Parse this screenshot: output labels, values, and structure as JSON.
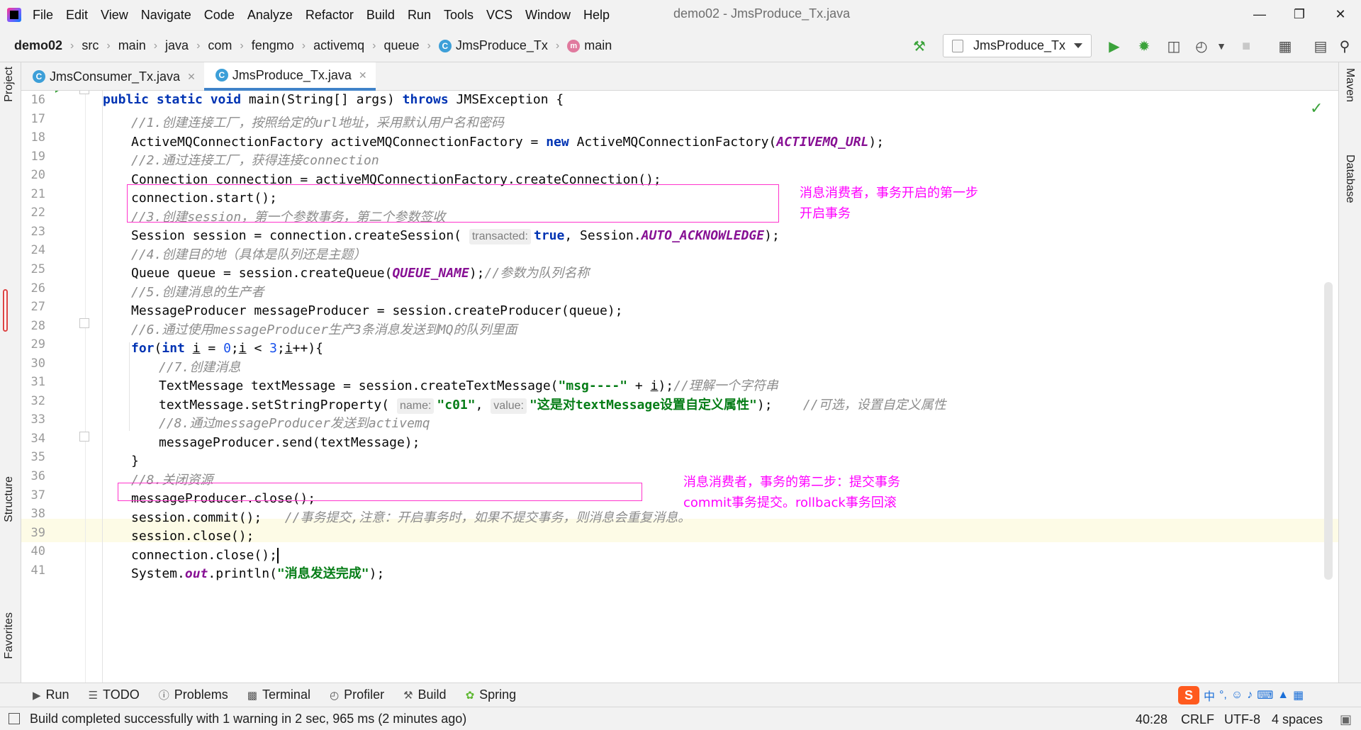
{
  "menubar": {
    "items": [
      "File",
      "Edit",
      "View",
      "Navigate",
      "Code",
      "Analyze",
      "Refactor",
      "Build",
      "Run",
      "Tools",
      "VCS",
      "Window",
      "Help"
    ],
    "window_title": "demo02 - JmsProduce_Tx.java"
  },
  "navbar": {
    "crumbs": [
      "demo02",
      "src",
      "main",
      "java",
      "com",
      "fengmo",
      "activemq",
      "queue"
    ],
    "class_crumb": "JmsProduce_Tx",
    "method_crumb": "main",
    "run_config": "JmsProduce_Tx"
  },
  "tabs": [
    {
      "label": "JmsConsumer_Tx.java",
      "active": false
    },
    {
      "label": "JmsProduce_Tx.java",
      "active": true
    }
  ],
  "left_tools": [
    "Project",
    "Structure",
    "Favorites"
  ],
  "right_tools": [
    "Maven",
    "Database"
  ],
  "gutter": {
    "line_numbers": [
      "16",
      "17",
      "18",
      "19",
      "20",
      "21",
      "22",
      "23",
      "24",
      "25",
      "26",
      "27",
      "28",
      "29",
      "30",
      "31",
      "32",
      "33",
      "34",
      "35",
      "36",
      "37",
      "38",
      "39",
      "40",
      "41"
    ]
  },
  "code": {
    "l16": {
      "kw1": "public static void ",
      "rest": "main(String[] args) ",
      "kw2": "throws ",
      "tail": "JMSException {"
    },
    "l17": {
      "comment": "//1.创建连接工厂，按照给定的url地址，采用默认用户名和密码"
    },
    "l18": {
      "a": "ActiveMQConnectionFactory activeMQConnectionFactory = ",
      "kw": "new ",
      "b": "ActiveMQConnectionFactory(",
      "const": "ACTIVEMQ_URL",
      "c": ");"
    },
    "l19": {
      "comment": "//2.通过连接工厂，获得连接connection"
    },
    "l20": {
      "text": "Connection connection = activeMQConnectionFactory.createConnection();"
    },
    "l21": {
      "text": "connection.start();"
    },
    "l22": {
      "comment": "//3.创建session，第一个参数事务，第二个参数签收"
    },
    "l23": {
      "a": "Session session = connection.createSession( ",
      "hint": "transacted:",
      "kw": "true",
      "b": ", Session.",
      "const": "AUTO_ACKNOWLEDGE",
      "c": ");"
    },
    "l24": {
      "comment": "//4.创建目的地（具体是队列还是主题）"
    },
    "l25": {
      "a": "Queue queue = session.createQueue(",
      "const": "QUEUE_NAME",
      "b": ");",
      "comment": "//参数为队列名称"
    },
    "l26": {
      "comment": "//5.创建消息的生产者"
    },
    "l27": {
      "text": "MessageProducer messageProducer = session.createProducer(queue);"
    },
    "l28": {
      "comment": "//6.通过使用messageProducer生产3条消息发送到MQ的队列里面"
    },
    "l29": {
      "kw1": "for",
      "a": "(",
      "kw2": "int ",
      "var1": "i",
      "b": " = ",
      "n1": "0",
      "c": ";",
      "var2": "i",
      "d": " < ",
      "n2": "3",
      "e": ";",
      "var3": "i",
      "f": "++){"
    },
    "l30": {
      "comment": "//7.创建消息"
    },
    "l31": {
      "a": "TextMessage textMessage = session.createTextMessage(",
      "str": "\"msg----\"",
      "b": " + ",
      "var": "i",
      "c": ");",
      "comment": "//理解一个字符串"
    },
    "l32": {
      "a": "textMessage.setStringProperty( ",
      "hint1": "name:",
      "str1": "\"c01\"",
      "b": ", ",
      "hint2": "value:",
      "str2": "\"这是对textMessage设置自定义属性\"",
      "c": ");    ",
      "comment": "//可选，设置自定义属性"
    },
    "l33": {
      "comment": "//8.通过messageProducer发送到activemq"
    },
    "l34": {
      "text": "messageProducer.send(textMessage);"
    },
    "l35": {
      "text": "}"
    },
    "l36": {
      "comment": "//8.关闭资源"
    },
    "l37": {
      "text": "messageProducer.close();"
    },
    "l38": {
      "a": "session.commit();   ",
      "comment": "//事务提交,注意：开启事务时，如果不提交事务，则消息会重复消息。"
    },
    "l39": {
      "text": "session.close();"
    },
    "l40": {
      "text": "connection.close();"
    },
    "l41": {
      "a": "System.",
      "const": "out",
      "b": ".println(",
      "str": "\"消息发送完成\"",
      "c": ");"
    }
  },
  "annotations": {
    "note1": [
      "消息消费者，事务开启的第一步",
      "开启事务"
    ],
    "note2": [
      "消息消费者，事务的第二步：提交事务",
      "commit事务提交。rollback事务回滚"
    ]
  },
  "toolwindows": [
    "Run",
    "TODO",
    "Problems",
    "Terminal",
    "Profiler",
    "Build",
    "Spring"
  ],
  "ime": {
    "lang": "中",
    "punct": "°,"
  },
  "status": {
    "message": "Build completed successfully with 1 warning in 2 sec, 965 ms (2 minutes ago)",
    "position": "40:28",
    "line_sep": "CRLF",
    "encoding": "UTF-8",
    "indent": "4 spaces"
  },
  "colors": {
    "annotation": "#ff00ff",
    "keyword": "#0033b3",
    "string": "#067d17",
    "constant": "#871094",
    "comment": "#8c8c8c"
  }
}
